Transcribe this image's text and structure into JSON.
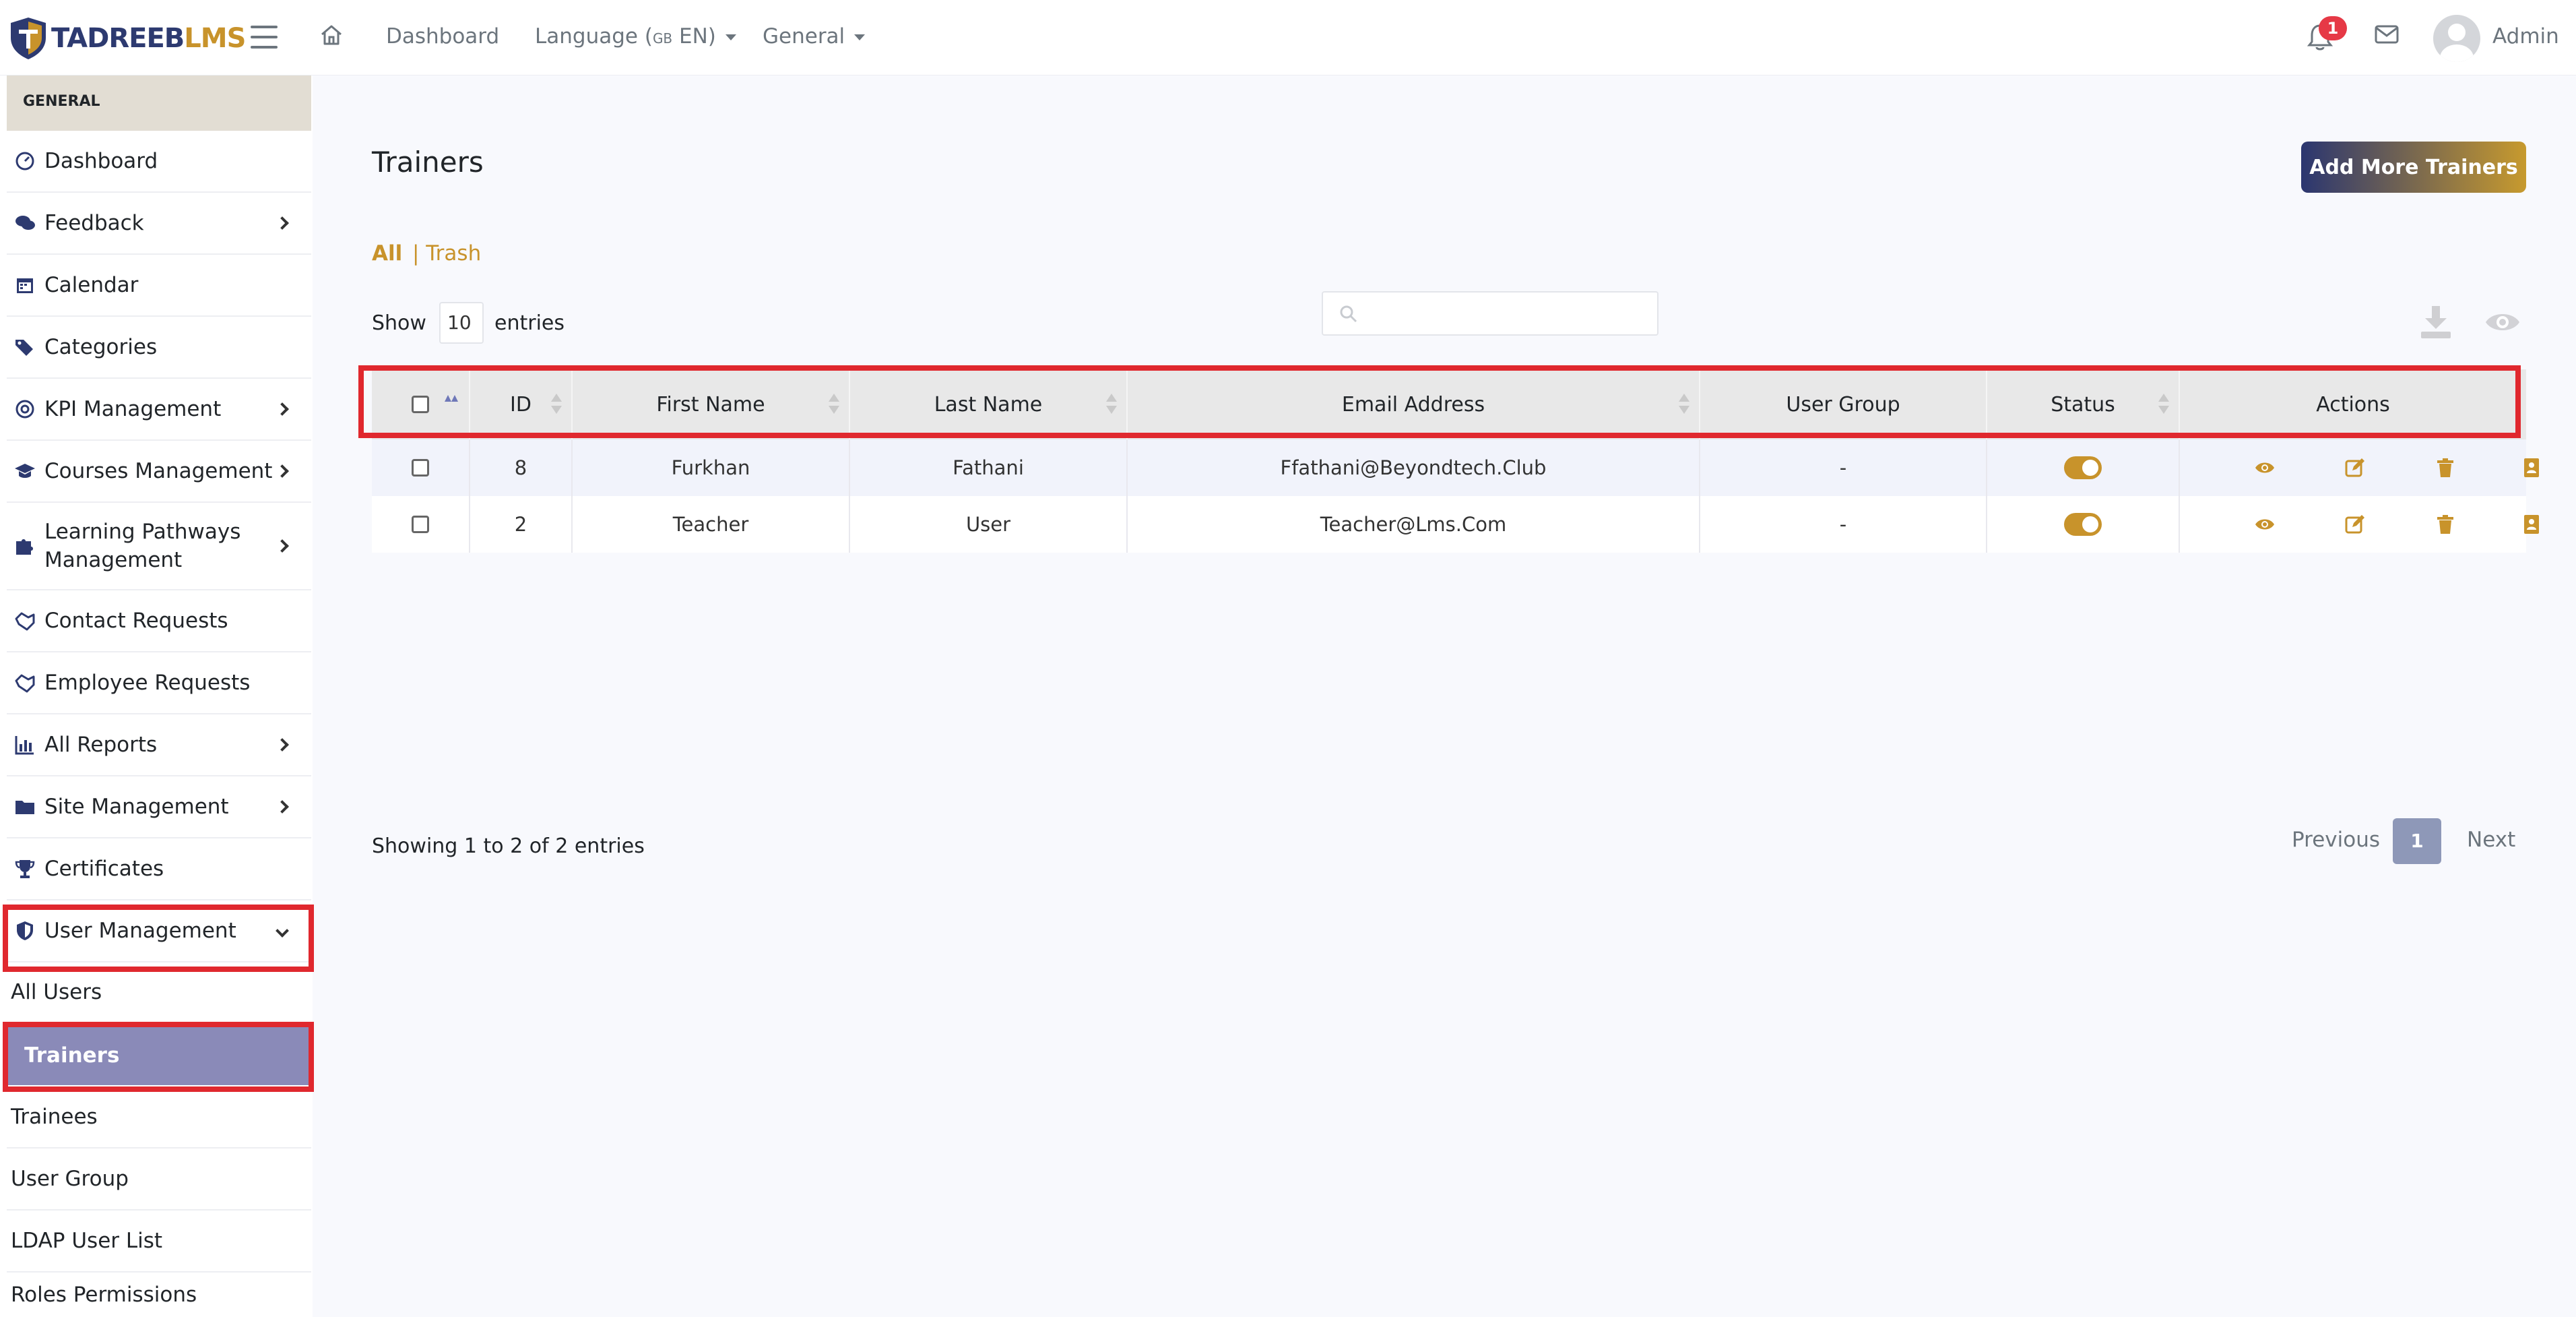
{
  "brand": {
    "logo_part1": "TADREEB",
    "logo_part2": "LMS"
  },
  "topnav": {
    "dashboard": "Dashboard",
    "language_label": "Language (",
    "language_flag": "GB",
    "language_code": " EN)",
    "general": "General",
    "notification_count": "1",
    "admin_name": "Admin"
  },
  "sidebar": {
    "header": "GENERAL",
    "items": [
      {
        "label": "Dashboard"
      },
      {
        "label": "Feedback"
      },
      {
        "label": "Calendar"
      },
      {
        "label": "Categories"
      },
      {
        "label": "KPI Management"
      },
      {
        "label": "Courses Management"
      },
      {
        "label": "Learning Pathways"
      },
      {
        "label": "Management"
      },
      {
        "label": "Contact Requests"
      },
      {
        "label": "Employee Requests"
      },
      {
        "label": "All Reports"
      },
      {
        "label": "Site Management"
      },
      {
        "label": "Certificates"
      },
      {
        "label": "User Management"
      }
    ],
    "subitems": [
      {
        "label": "All Users"
      },
      {
        "label": "Trainers"
      },
      {
        "label": "Trainees"
      },
      {
        "label": "User Group"
      },
      {
        "label": "LDAP User List"
      },
      {
        "label": "Roles Permissions"
      }
    ]
  },
  "main": {
    "title": "Trainers",
    "add_button": "Add More Trainers",
    "filters": {
      "all": "All",
      "trash": "| Trash"
    },
    "show_label": "Show",
    "show_value": "10",
    "entries_label": "entries",
    "table": {
      "headers": [
        "ID",
        "First Name",
        "Last Name",
        "Email Address",
        "User Group",
        "Status",
        "Actions"
      ],
      "rows": [
        {
          "id": "8",
          "first": "Furkhan",
          "last": "Fathani",
          "email": "Ffathani@Beyondtech.Club",
          "group": "-"
        },
        {
          "id": "2",
          "first": "Teacher",
          "last": "User",
          "email": "Teacher@Lms.Com",
          "group": "-"
        }
      ]
    },
    "info": "Showing 1 to 2 of 2 entries",
    "pagination": {
      "previous": "Previous",
      "current": "1",
      "next": "Next"
    }
  },
  "colors": {
    "accent": "#c8932b",
    "brand_navy": "#2d3a70",
    "active_item": "#8a8ab8",
    "highlight": "#e0282e"
  }
}
